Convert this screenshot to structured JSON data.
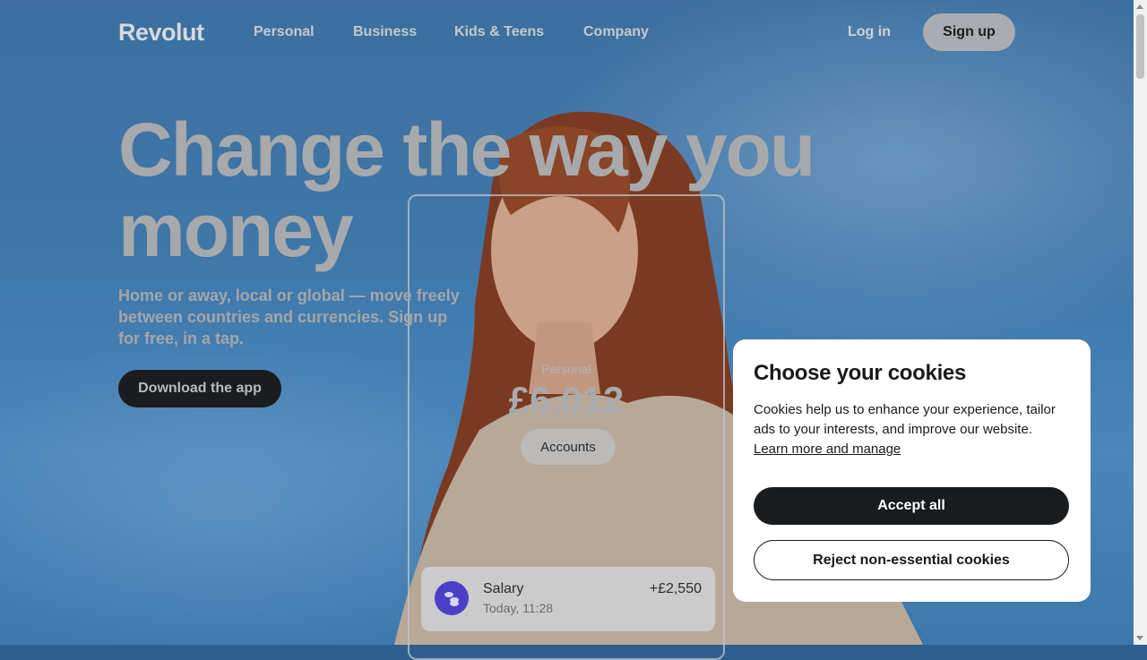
{
  "header": {
    "logo": "Revolut",
    "nav": [
      "Personal",
      "Business",
      "Kids & Teens",
      "Company"
    ],
    "login_label": "Log in",
    "signup_label": "Sign up"
  },
  "hero": {
    "headline": "Change the way you money",
    "subtext": "Home or away, local or global — move freely between countries and currencies. Sign up for free, in a tap.",
    "cta_label": "Download the app"
  },
  "account_card": {
    "label": "Personal",
    "balance": "£6,012",
    "button_label": "Accounts",
    "transaction": {
      "title": "Salary",
      "subtitle": "Today, 11:28",
      "amount": "+£2,550",
      "icon": "coins-icon"
    }
  },
  "cookie_banner": {
    "title": "Choose your cookies",
    "body": "Cookies help us to enhance your experience, tailor ads to your interests, and improve our website.",
    "link_label": "Learn more and manage",
    "accept_label": "Accept all",
    "reject_label": "Reject non-essential cookies"
  },
  "colors": {
    "sky": "#3f77a9",
    "dark_button": "#191c1f",
    "accent_purple": "#4b3fc7"
  }
}
